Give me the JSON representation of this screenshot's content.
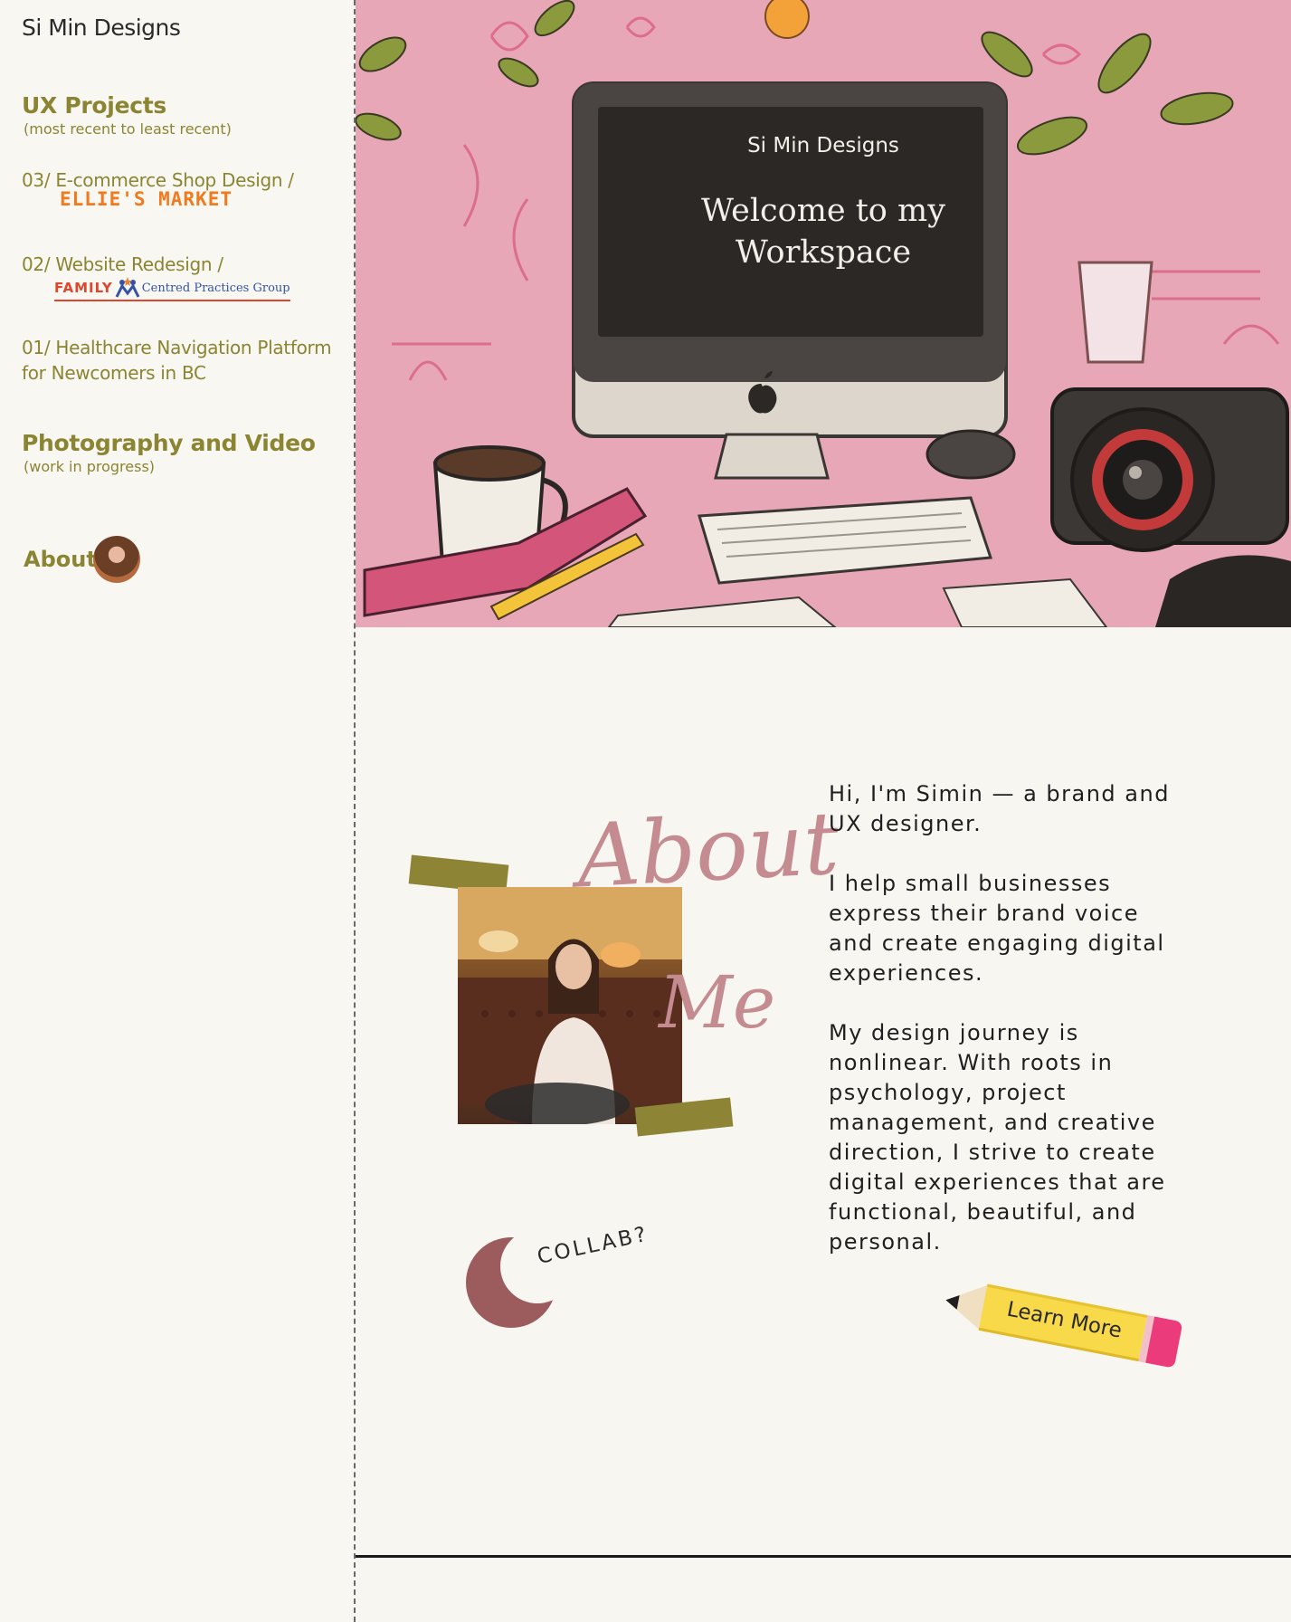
{
  "sidebar": {
    "brand": "Si Min Designs",
    "ux_title": "UX Projects",
    "ux_subtitle": "(most recent to least recent)",
    "projects": [
      {
        "label": "03/  E-commerce Shop Design /",
        "logo_text": "ELLIE'S MARKET"
      },
      {
        "label": "02/  Website Redesign /",
        "logo_text_family": "FAMILY",
        "logo_text_rest": "Centred Practices Group"
      },
      {
        "label": "01/  Healthcare Navigation Platform for Newcomers in BC"
      }
    ],
    "photo_title": "Photography and Video",
    "photo_subtitle": "(work in progress)",
    "about_label": "About"
  },
  "hero": {
    "screen_brand": "Si Min Designs",
    "screen_title_line1": "Welcome to my",
    "screen_title_line2": "Workspace"
  },
  "about": {
    "heading_about": "About",
    "heading_me": "Me",
    "collab": "COLLAB?",
    "bio": [
      "Hi, I'm Simin — a brand and UX designer.",
      "I help small businesses express their brand voice and create engaging digital experiences.",
      "My design journey is nonlinear. With roots in psychology, project management, and creative direction, I strive to create digital experiences that are functional, beautiful, and personal."
    ],
    "learn_more": "Learn More"
  },
  "colors": {
    "olive": "#8b8432",
    "rose": "#c48b90",
    "hero_pink": "#e8a7b7",
    "collab_circle": "#9c5c5e",
    "pencil_yellow": "#f7d94a",
    "eraser_pink": "#ec3b7a"
  },
  "icons": [
    "apple-logo-icon",
    "family-logo-icon",
    "pencil-button-icon"
  ]
}
